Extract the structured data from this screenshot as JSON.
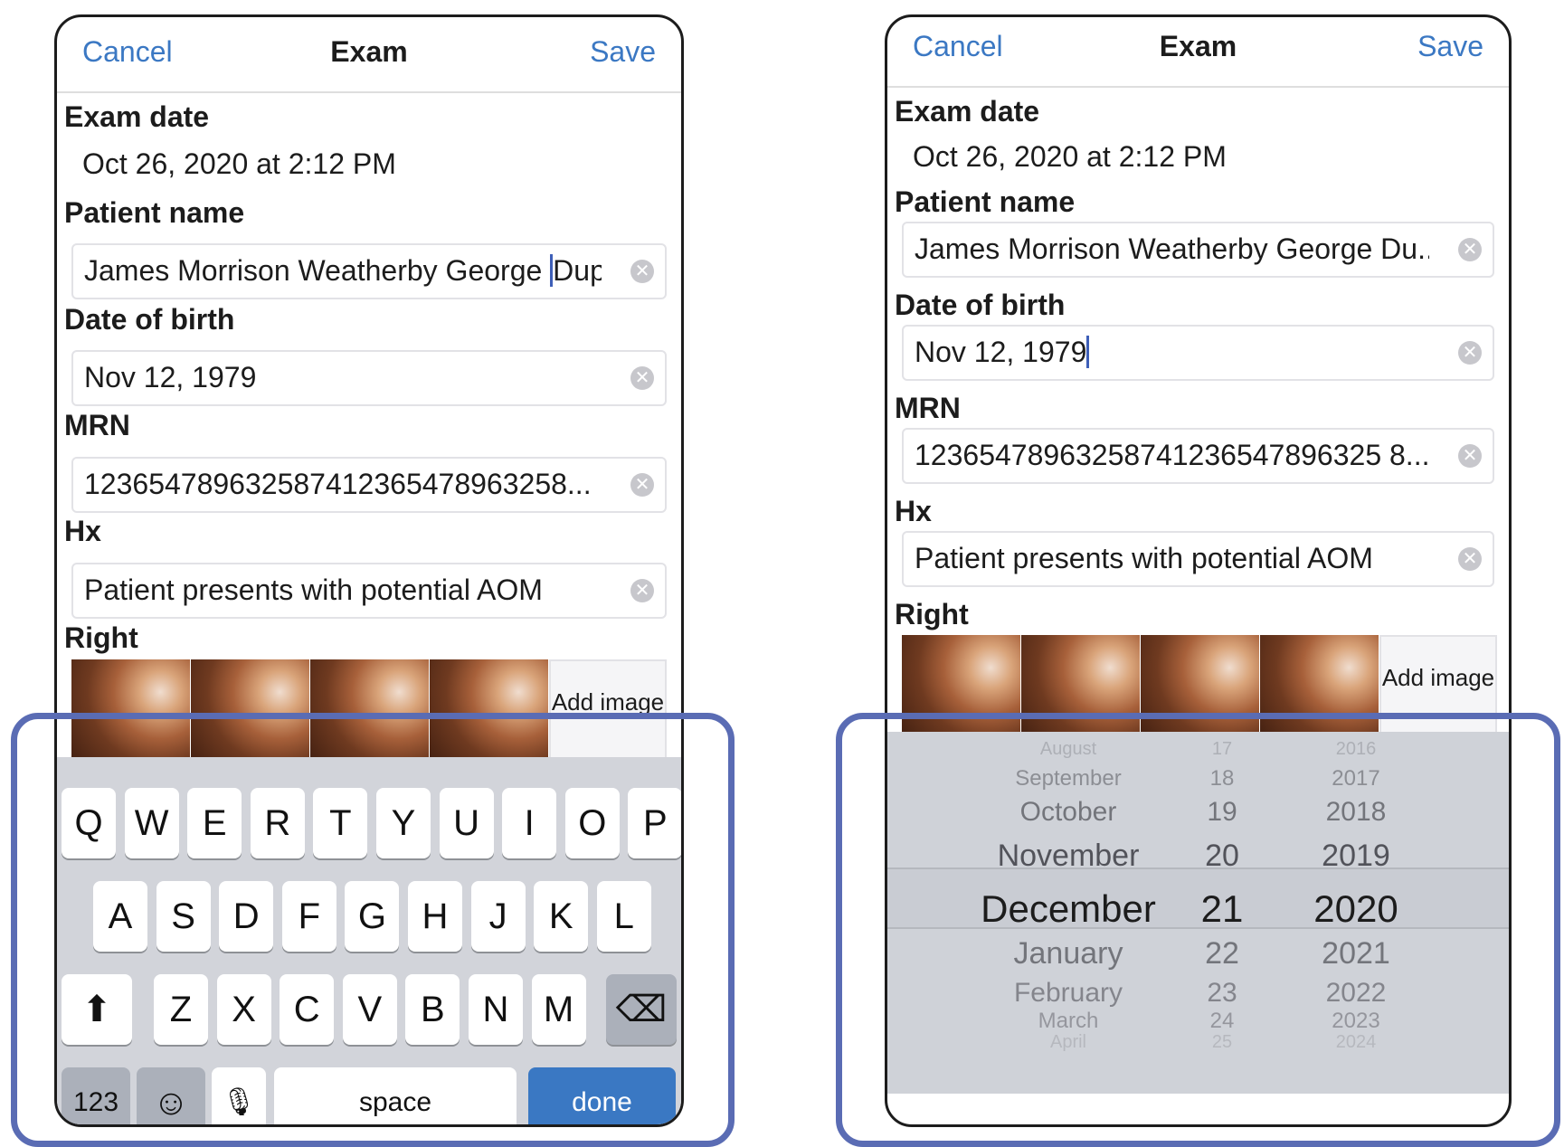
{
  "left": {
    "nav": {
      "cancel": "Cancel",
      "title": "Exam",
      "save": "Save"
    },
    "exam_date_label": "Exam date",
    "exam_date_value": "Oct 26, 2020 at 2:12 PM",
    "patient_name_label": "Patient name",
    "patient_name_value": "James Morrison Weatherby George ",
    "patient_name_value_after_caret": "Dupre",
    "dob_label": "Date of birth",
    "dob_value": "Nov 12, 1979",
    "mrn_label": "MRN",
    "mrn_value": "123654789632587412365478963258...",
    "hx_label": "Hx",
    "hx_value": "Patient presents with potential AOM",
    "right_label": "Right",
    "add_image": "Add image",
    "keyboard": {
      "row1": [
        "Q",
        "W",
        "E",
        "R",
        "T",
        "Y",
        "U",
        "I",
        "O",
        "P"
      ],
      "row2": [
        "A",
        "S",
        "D",
        "F",
        "G",
        "H",
        "J",
        "K",
        "L"
      ],
      "row3": [
        "Z",
        "X",
        "C",
        "V",
        "B",
        "N",
        "M"
      ],
      "numbers": "123",
      "space": "space",
      "done": "done"
    }
  },
  "right": {
    "nav": {
      "cancel": "Cancel",
      "title": "Exam",
      "save": "Save"
    },
    "exam_date_label": "Exam date",
    "exam_date_value": "Oct 26, 2020 at 2:12 PM",
    "patient_name_label": "Patient name",
    "patient_name_value": "James Morrison Weatherby George Du...",
    "dob_label": "Date of birth",
    "dob_value": "Nov 12, 1979",
    "mrn_label": "MRN",
    "mrn_value": "12365478963258741236547896325 8...",
    "hx_label": "Hx",
    "hx_value": "Patient presents with potential AOM",
    "right_label": "Right",
    "add_image": "Add image",
    "picker": {
      "months": [
        "August",
        "September",
        "October",
        "November",
        "December",
        "January",
        "February",
        "March",
        "April"
      ],
      "days": [
        "17",
        "18",
        "19",
        "20",
        "21",
        "22",
        "23",
        "24",
        "25"
      ],
      "years": [
        "2016",
        "2017",
        "2018",
        "2019",
        "2020",
        "2021",
        "2022",
        "2023",
        "2024"
      ],
      "selected_index": 4
    }
  }
}
